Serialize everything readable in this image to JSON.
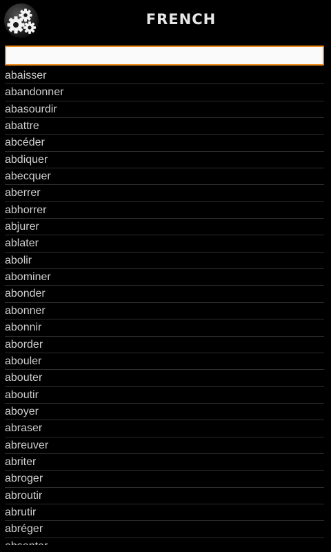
{
  "header": {
    "title": "FRENCH",
    "settings_icon": "gears-icon"
  },
  "search": {
    "value": "",
    "placeholder": ""
  },
  "words": [
    "abaisser",
    "abandonner",
    "abasourdir",
    "abattre",
    "abcéder",
    "abdiquer",
    "abecquer",
    "aberrer",
    "abhorrer",
    "abjurer",
    "ablater",
    "abolir",
    "abominer",
    "abonder",
    "abonner",
    "abonnir",
    "aborder",
    "abouler",
    "abouter",
    "aboutir",
    "aboyer",
    "abraser",
    "abreuver",
    "abriter",
    "abroger",
    "abroutir",
    "abrutir",
    "abréger",
    "absenter"
  ]
}
